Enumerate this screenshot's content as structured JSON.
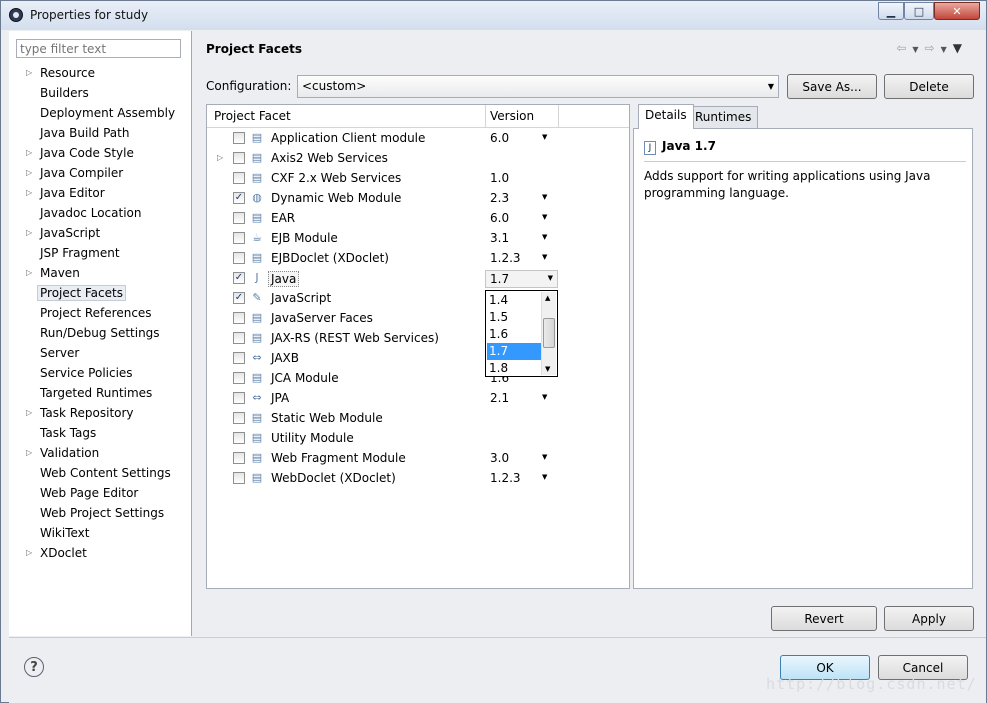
{
  "window": {
    "title": "Properties for study"
  },
  "sidebar": {
    "filter_placeholder": "type filter text",
    "items": [
      {
        "label": "Resource",
        "expandable": true
      },
      {
        "label": "Builders",
        "expandable": false
      },
      {
        "label": "Deployment Assembly",
        "expandable": false
      },
      {
        "label": "Java Build Path",
        "expandable": false
      },
      {
        "label": "Java Code Style",
        "expandable": true
      },
      {
        "label": "Java Compiler",
        "expandable": true
      },
      {
        "label": "Java Editor",
        "expandable": true
      },
      {
        "label": "Javadoc Location",
        "expandable": false
      },
      {
        "label": "JavaScript",
        "expandable": true
      },
      {
        "label": "JSP Fragment",
        "expandable": false
      },
      {
        "label": "Maven",
        "expandable": true
      },
      {
        "label": "Project Facets",
        "expandable": false,
        "selected": true
      },
      {
        "label": "Project References",
        "expandable": false
      },
      {
        "label": "Run/Debug Settings",
        "expandable": false
      },
      {
        "label": "Server",
        "expandable": false
      },
      {
        "label": "Service Policies",
        "expandable": false
      },
      {
        "label": "Targeted Runtimes",
        "expandable": false
      },
      {
        "label": "Task Repository",
        "expandable": true
      },
      {
        "label": "Task Tags",
        "expandable": false
      },
      {
        "label": "Validation",
        "expandable": true
      },
      {
        "label": "Web Content Settings",
        "expandable": false
      },
      {
        "label": "Web Page Editor",
        "expandable": false
      },
      {
        "label": "Web Project Settings",
        "expandable": false
      },
      {
        "label": "WikiText",
        "expandable": false
      },
      {
        "label": "XDoclet",
        "expandable": true
      }
    ]
  },
  "page": {
    "title": "Project Facets",
    "configuration_label": "Configuration:",
    "configuration_value": "<custom>",
    "save_as": "Save As...",
    "delete": "Delete",
    "revert": "Revert",
    "apply": "Apply"
  },
  "facets": {
    "col_facet": "Project Facet",
    "col_version": "Version",
    "rows": [
      {
        "name": "Application Client module",
        "version": "6.0",
        "checked": false,
        "dropdown": true,
        "expandable": false,
        "icon": "page-icon"
      },
      {
        "name": "Axis2 Web Services",
        "version": "",
        "checked": false,
        "dropdown": false,
        "expandable": true,
        "icon": "page-icon"
      },
      {
        "name": "CXF 2.x Web Services",
        "version": "1.0",
        "checked": false,
        "dropdown": false,
        "expandable": false,
        "icon": "page-icon"
      },
      {
        "name": "Dynamic Web Module",
        "version": "2.3",
        "checked": true,
        "dropdown": true,
        "expandable": false,
        "icon": "globe-icon"
      },
      {
        "name": "EAR",
        "version": "6.0",
        "checked": false,
        "dropdown": true,
        "expandable": false,
        "icon": "page-icon"
      },
      {
        "name": "EJB Module",
        "version": "3.1",
        "checked": false,
        "dropdown": true,
        "expandable": false,
        "icon": "bean-icon"
      },
      {
        "name": "EJBDoclet (XDoclet)",
        "version": "1.2.3",
        "checked": false,
        "dropdown": true,
        "expandable": false,
        "icon": "page-icon"
      },
      {
        "name": "Java",
        "version": "",
        "checked": true,
        "dropdown": false,
        "expandable": false,
        "icon": "java-icon",
        "selected": true
      },
      {
        "name": "JavaScript",
        "version": "",
        "checked": true,
        "dropdown": false,
        "expandable": false,
        "icon": "js-icon"
      },
      {
        "name": "JavaServer Faces",
        "version": "",
        "checked": false,
        "dropdown": false,
        "expandable": false,
        "icon": "page-icon"
      },
      {
        "name": "JAX-RS (REST Web Services)",
        "version": "",
        "checked": false,
        "dropdown": false,
        "expandable": false,
        "icon": "page-icon"
      },
      {
        "name": "JAXB",
        "version": "",
        "checked": false,
        "dropdown": false,
        "expandable": false,
        "icon": "arrows-icon"
      },
      {
        "name": "JCA Module",
        "version": "1.6",
        "checked": false,
        "dropdown": false,
        "expandable": false,
        "icon": "page-icon"
      },
      {
        "name": "JPA",
        "version": "2.1",
        "checked": false,
        "dropdown": true,
        "expandable": false,
        "icon": "arrows-icon"
      },
      {
        "name": "Static Web Module",
        "version": "",
        "checked": false,
        "dropdown": false,
        "expandable": false,
        "icon": "page-icon"
      },
      {
        "name": "Utility Module",
        "version": "",
        "checked": false,
        "dropdown": false,
        "expandable": false,
        "icon": "page-icon"
      },
      {
        "name": "Web Fragment Module",
        "version": "3.0",
        "checked": false,
        "dropdown": true,
        "expandable": false,
        "icon": "page-icon"
      },
      {
        "name": "WebDoclet (XDoclet)",
        "version": "1.2.3",
        "checked": false,
        "dropdown": true,
        "expandable": false,
        "icon": "page-icon"
      }
    ],
    "java_version_selected": "1.7",
    "java_version_options": [
      "1.4",
      "1.5",
      "1.6",
      "1.7",
      "1.8"
    ]
  },
  "details": {
    "tab_details": "Details",
    "tab_runtimes": "Runtimes",
    "heading": "Java 1.7",
    "description": "Adds support for writing applications using Java programming language."
  },
  "footer": {
    "ok": "OK",
    "cancel": "Cancel",
    "help": "?"
  },
  "watermark": "http://blog.csdn.net/"
}
